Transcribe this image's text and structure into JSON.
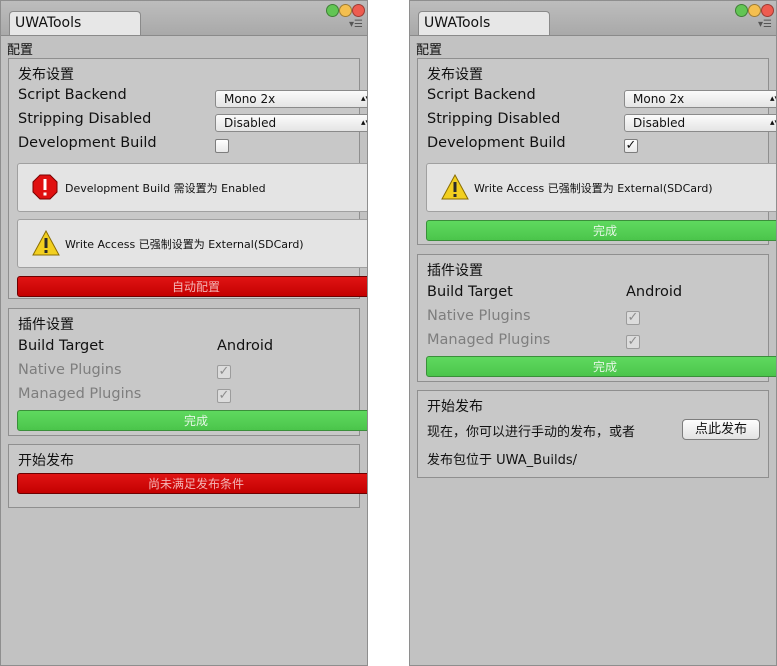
{
  "colors": {
    "red_button": "#d40000",
    "green_button": "#55cf55",
    "panel_bg": "#c2c2c2",
    "error_red": "#e01010",
    "warning_yellow": "#f2cf1f"
  },
  "left": {
    "tab_title": "UWATools",
    "config_label": "配置",
    "publish_settings": {
      "title": "发布设置",
      "script_backend": {
        "label": "Script Backend",
        "value": "Mono 2x"
      },
      "stripping": {
        "label": "Stripping Disabled",
        "value": "Disabled"
      },
      "dev_build": {
        "label": "Development Build",
        "checked": false
      },
      "error_box": {
        "icon": "error-octagon-icon",
        "text": "Development Build 需设置为 Enabled"
      },
      "warning_box": {
        "icon": "warning-triangle-icon",
        "text": "Write Access 已强制设置为 External(SDCard)"
      },
      "action_button": "自动配置"
    },
    "plugin_settings": {
      "title": "插件设置",
      "build_target": {
        "label": "Build Target",
        "value": "Android"
      },
      "native_plugins": {
        "label": "Native Plugins",
        "checked": true
      },
      "managed_plugins": {
        "label": "Managed Plugins",
        "checked": true
      },
      "done_button": "完成"
    },
    "start_publish": {
      "title": "开始发布",
      "blocked_button": "尚未满足发布条件"
    }
  },
  "right": {
    "tab_title": "UWATools",
    "config_label": "配置",
    "publish_settings": {
      "title": "发布设置",
      "script_backend": {
        "label": "Script Backend",
        "value": "Mono 2x"
      },
      "stripping": {
        "label": "Stripping Disabled",
        "value": "Disabled"
      },
      "dev_build": {
        "label": "Development Build",
        "checked": true
      },
      "warning_box": {
        "icon": "warning-triangle-icon",
        "text": "Write Access 已强制设置为 External(SDCard)"
      },
      "done_button": "完成"
    },
    "plugin_settings": {
      "title": "插件设置",
      "build_target": {
        "label": "Build Target",
        "value": "Android"
      },
      "native_plugins": {
        "label": "Native Plugins",
        "checked": true
      },
      "managed_plugins": {
        "label": "Managed Plugins",
        "checked": true
      },
      "done_button": "完成"
    },
    "start_publish": {
      "title": "开始发布",
      "manual_text": "现在，你可以进行手动的发布，或者",
      "publish_button": "点此发布",
      "output_text": "发布包位于 UWA_Builds/"
    }
  }
}
